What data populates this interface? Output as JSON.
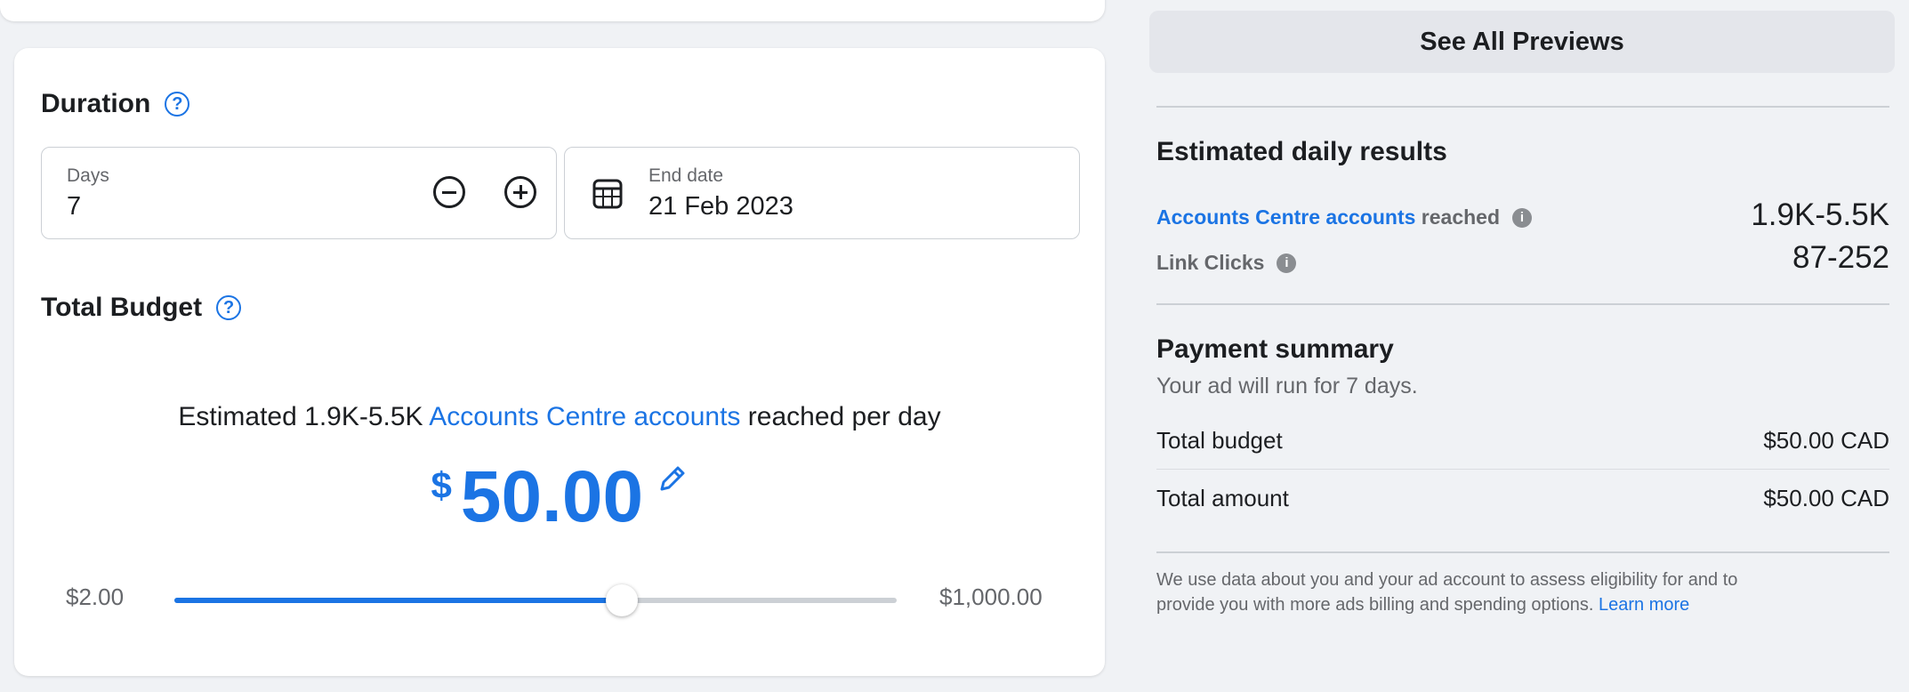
{
  "duration": {
    "title": "Duration",
    "days_label": "Days",
    "days_value": "7",
    "end_date_label": "End date",
    "end_date_value": "21 Feb 2023"
  },
  "budget": {
    "title": "Total Budget",
    "estimate_prefix": "Estimated 1.9K-5.5K",
    "estimate_link": "Accounts Centre accounts",
    "estimate_suffix": "reached per day",
    "currency_symbol": "$",
    "amount": "50.00",
    "slider_min": "$2.00",
    "slider_max": "$1,000.00",
    "slider_fraction": 0.62
  },
  "preview": {
    "see_all_label": "See All Previews"
  },
  "results": {
    "title": "Estimated daily results",
    "reached_link": "Accounts Centre accounts",
    "reached_suffix": "reached",
    "reached_value": "1.9K-5.5K",
    "clicks_label": "Link Clicks",
    "clicks_value": "87-252"
  },
  "payment": {
    "title": "Payment summary",
    "subtitle": "Your ad will run for 7 days.",
    "rows": [
      {
        "label": "Total budget",
        "value": "$50.00 CAD"
      },
      {
        "label": "Total amount",
        "value": "$50.00 CAD"
      }
    ],
    "disclaimer": "We use data about you and your ad account to assess eligibility for and to provide you with more ads billing and spending options.",
    "learn_more": "Learn more"
  },
  "colors": {
    "accent": "#1b74e4",
    "track_inactive": "#ccd0d5",
    "background": "#f0f2f5"
  }
}
